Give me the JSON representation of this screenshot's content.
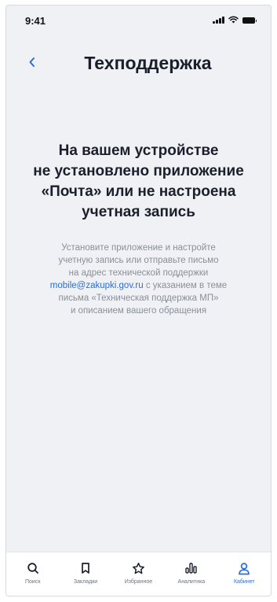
{
  "status_bar": {
    "time": "9:41"
  },
  "header": {
    "title": "Техподдержка",
    "back_icon": "chevron-left-icon"
  },
  "message": {
    "headline_lines": [
      "На вашем устройстве",
      "не установлено приложение",
      "«Почта» или не настроена",
      "учетная запись"
    ],
    "body_lines": [
      "Установите приложение и настройте",
      "учетную запись или отправьте письмо",
      "на адрес технической поддержки"
    ],
    "email": "mobile@zakupki.gov.ru",
    "email_suffix": " с указанием в теме",
    "body_lines_after": [
      "письма «Техническая поддержка МП»",
      "и описанием вашего обращения"
    ]
  },
  "tab_bar": {
    "items": [
      {
        "label": "Поиск",
        "icon": "search-icon"
      },
      {
        "label": "Закладки",
        "icon": "bookmark-icon"
      },
      {
        "label": "Избранное",
        "icon": "star-icon"
      },
      {
        "label": "Аналитика",
        "icon": "bar-chart-icon"
      },
      {
        "label": "Кабинет",
        "icon": "user-icon",
        "active": true
      }
    ]
  },
  "colors": {
    "accent": "#2c6ed5",
    "background": "#eff1f5",
    "text": "#1a1f2b",
    "muted": "#8a8f99"
  }
}
